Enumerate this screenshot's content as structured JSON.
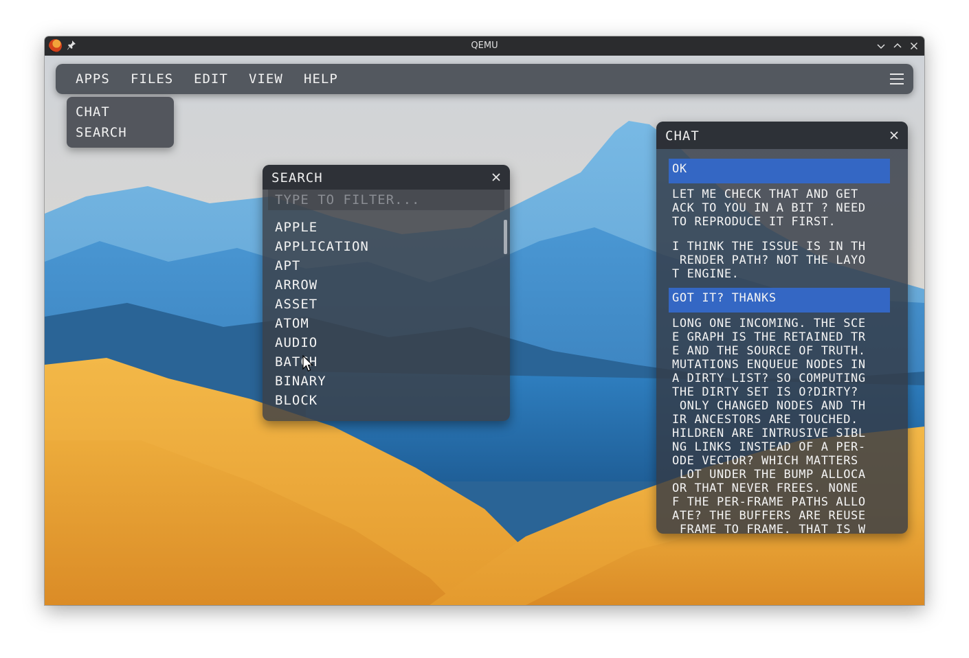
{
  "window": {
    "title": "QEMU"
  },
  "menubar": {
    "items": [
      "APPS",
      "FILES",
      "EDIT",
      "VIEW",
      "HELP"
    ]
  },
  "apps_menu": {
    "items": [
      "CHAT",
      "SEARCH"
    ]
  },
  "search": {
    "title": "SEARCH",
    "placeholder": "TYPE TO FILTER...",
    "results": [
      "APPLE",
      "APPLICATION",
      "APT",
      "ARROW",
      "ASSET",
      "ATOM",
      "AUDIO",
      "BATCH",
      "BINARY",
      "BLOCK"
    ]
  },
  "chat": {
    "title": "CHAT",
    "messages": [
      {
        "from": "me",
        "text": "OK"
      },
      {
        "from": "them",
        "text": "LET ME CHECK THAT AND GET\nACK TO YOU IN A BIT ? NEED\nTO REPRODUCE IT FIRST."
      },
      {
        "from": "them",
        "text": "I THINK THE ISSUE IS IN TH\n RENDER PATH? NOT THE LAYO\nT ENGINE."
      },
      {
        "from": "me",
        "text": "GOT IT? THANKS"
      },
      {
        "from": "them",
        "text": "LONG ONE INCOMING. THE SCE\nE GRAPH IS THE RETAINED TR\nE AND THE SOURCE OF TRUTH.\nMUTATIONS ENQUEUE NODES IN\nA DIRTY LIST? SO COMPUTING\nTHE DIRTY SET IS O?DIRTY?\n ONLY CHANGED NODES AND TH\nIR ANCESTORS ARE TOUCHED.\nHILDREN ARE INTRUSIVE SIBL\nNG LINKS INSTEAD OF A PER-\nODE VECTOR? WHICH MATTERS\n LOT UNDER THE BUMP ALLOCA\nOR THAT NEVER FREES. NONE\nF THE PER-FRAME PATHS ALLO\nATE? THE BUFFERS ARE REUSE\n FRAME TO FRAME. THAT IS W"
      }
    ]
  },
  "colors": {
    "menubar_bg": "#4e5259",
    "panel_header_bg": "#2c2f36",
    "my_message_bg": "#3467c4",
    "text": "#f4f4f4"
  }
}
